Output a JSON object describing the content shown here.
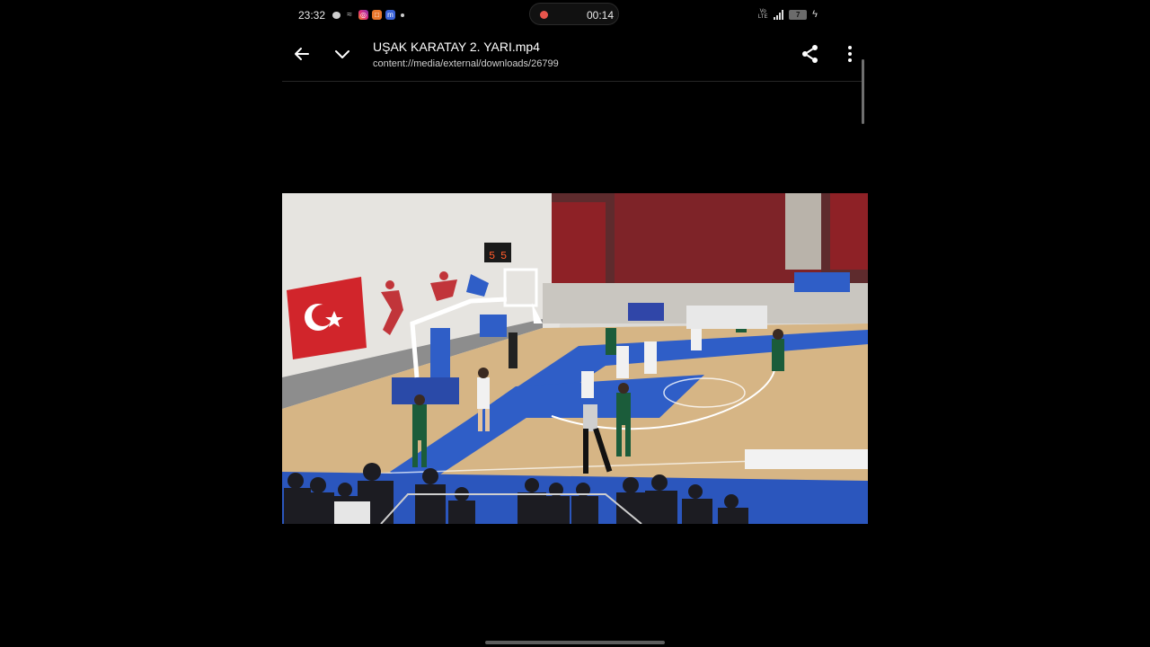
{
  "status_bar": {
    "time": "23:32",
    "notification_icons": [
      "chat-bubble-icon",
      "wave-icon",
      "instagram-icon",
      "app-orange-icon",
      "messenger-m-icon",
      "more-dot-icon"
    ],
    "rec_timer": "00:14",
    "volte_label": "Vo LTE",
    "battery_level": "7"
  },
  "app_bar": {
    "title": "UŞAK KARATAY 2. YARI.mp4",
    "subtitle": "content://media/external/downloads/26799"
  },
  "video": {
    "scoreboard": [
      "5",
      "5"
    ],
    "colors": {
      "court_wood": "#d6b585",
      "court_blue": "#2f5ec7",
      "flag_red": "#d1252b",
      "team_green": "#1b5c3a",
      "seats_red": "#8e2126"
    }
  }
}
